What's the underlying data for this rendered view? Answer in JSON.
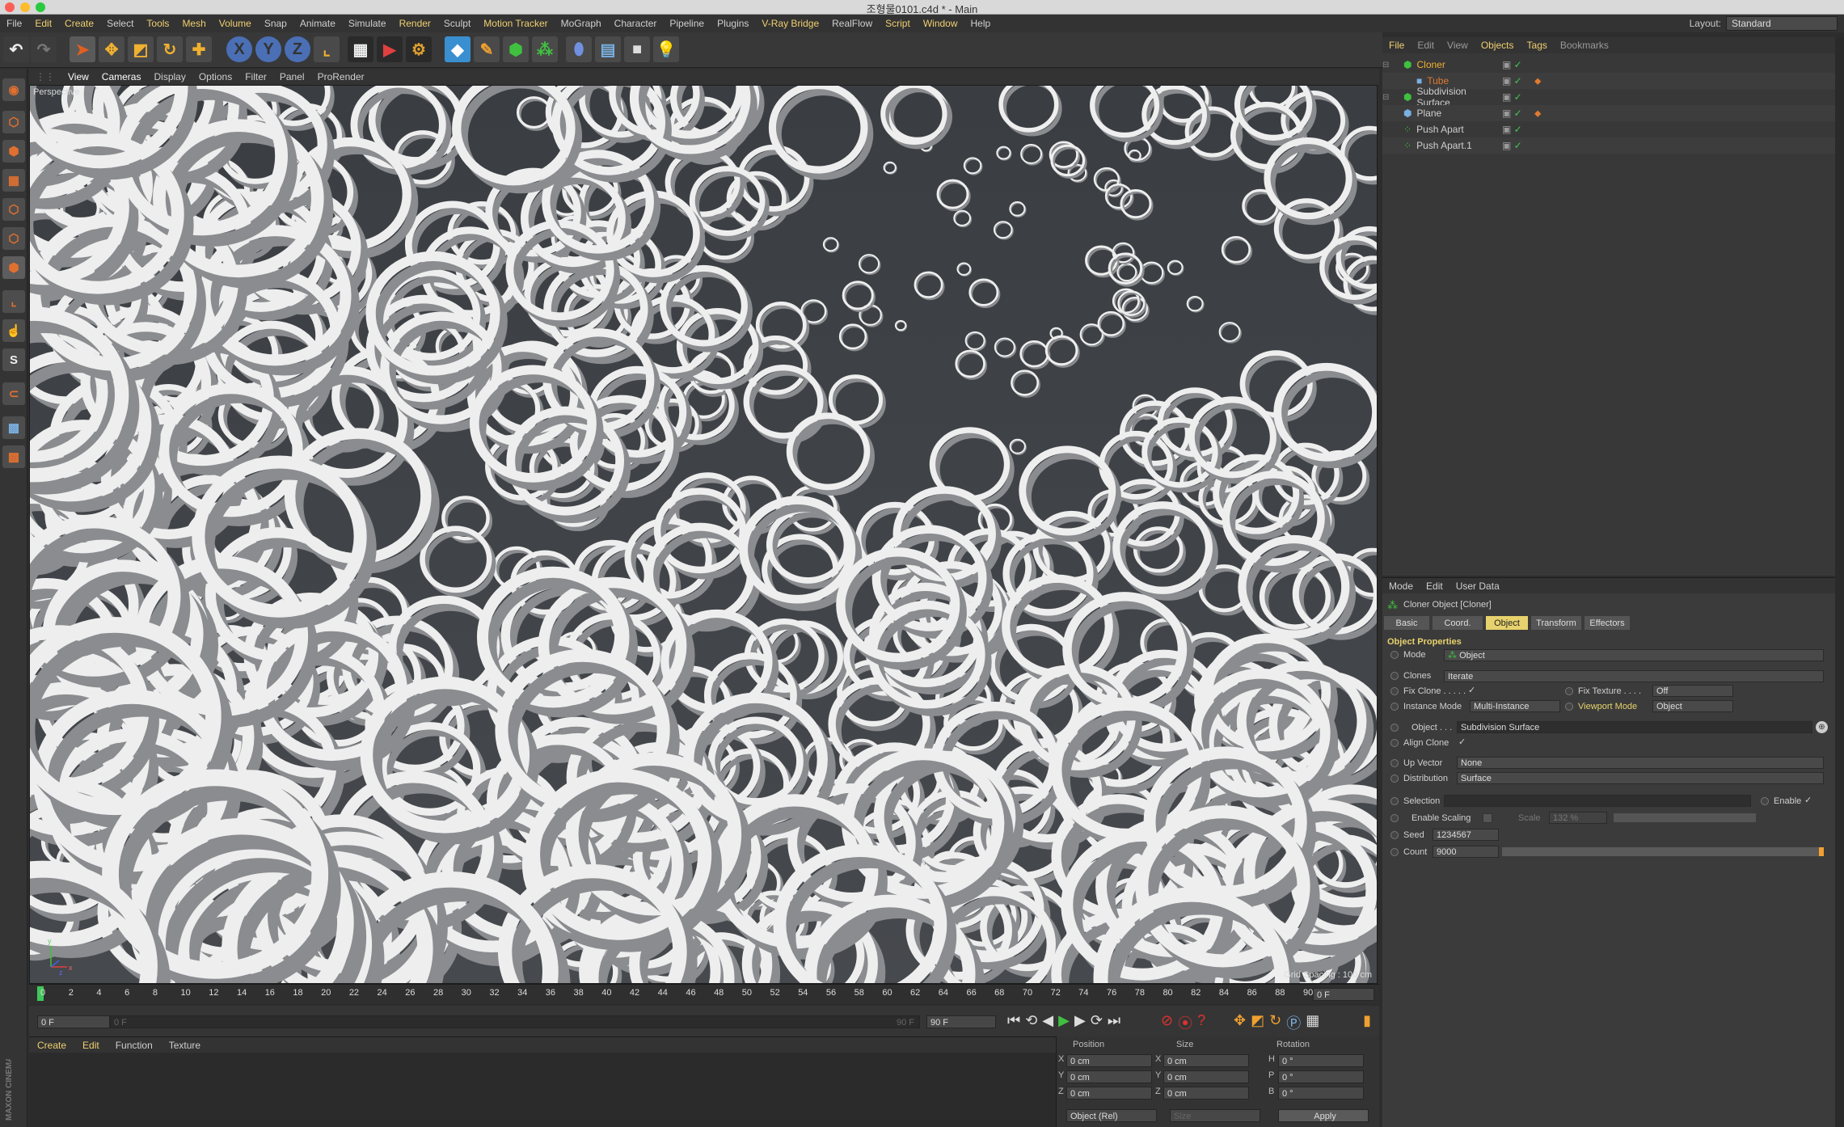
{
  "window": {
    "title": "조형물0101.c4d * - Main"
  },
  "menubar": {
    "items": [
      "File",
      "Edit",
      "Create",
      "Select",
      "Tools",
      "Mesh",
      "Volume",
      "Snap",
      "Animate",
      "Simulate",
      "Render",
      "Sculpt",
      "Motion Tracker",
      "MoGraph",
      "Character",
      "Pipeline",
      "Plugins",
      "V-Ray Bridge",
      "RealFlow",
      "Script",
      "Window",
      "Help"
    ],
    "highlighted": [
      "Edit",
      "Create",
      "Tools",
      "Mesh",
      "Volume",
      "Render",
      "Motion Tracker",
      "V-Ray Bridge",
      "Script",
      "Window"
    ],
    "layout_label": "Layout:",
    "layout_value": "Standard"
  },
  "toolbar": {
    "axis_x": "X",
    "axis_y": "Y",
    "axis_z": "Z",
    "icons": [
      "undo-icon",
      "redo-icon",
      "select-arrow-icon",
      "move-icon",
      "scale-icon",
      "rotate-icon",
      "add-icon",
      "x-axis-icon",
      "y-axis-icon",
      "z-axis-icon",
      "coordinate-system-icon",
      "render-view-icon",
      "render-picture-viewer-icon",
      "render-settings-icon",
      "cube-icon",
      "pen-icon",
      "subdivision-icon",
      "cloner-icon",
      "deformer-icon",
      "plane-grid-icon",
      "camera-icon",
      "light-icon"
    ]
  },
  "leftbar": {
    "icons": [
      "make-editable-icon",
      "model-mode-icon",
      "texture-mode-icon",
      "workplane-icon",
      "points-mode-icon",
      "edges-mode-icon",
      "polygons-mode-icon",
      "axis-mode-icon",
      "tweak-mode-icon",
      "solo-mode-icon",
      "snap-icon",
      "grid-snap-icon",
      "locked-workplane-icon"
    ],
    "solo_label": "S"
  },
  "viewport": {
    "menu": [
      "View",
      "Cameras",
      "Display",
      "Options",
      "Filter",
      "Panel",
      "ProRender"
    ],
    "active_menu": "View",
    "label": "Perspective",
    "grid_spacing": "Grid Spacing : 100 cm",
    "axis_labels": {
      "x": "x",
      "y": "y",
      "z": "z"
    }
  },
  "timeline": {
    "ticks": [
      "0",
      "2",
      "4",
      "6",
      "8",
      "10",
      "12",
      "14",
      "16",
      "18",
      "20",
      "22",
      "24",
      "26",
      "28",
      "30",
      "32",
      "34",
      "36",
      "38",
      "40",
      "42",
      "44",
      "46",
      "48",
      "50",
      "52",
      "54",
      "56",
      "58",
      "60",
      "62",
      "64",
      "66",
      "68",
      "70",
      "72",
      "74",
      "76",
      "78",
      "80",
      "82",
      "84",
      "86",
      "88",
      "90"
    ],
    "current_frame": "0 F",
    "start": "0 F",
    "range_start": "0 F",
    "range_end": "90 F",
    "end": "90 F",
    "end_frame": "90 F"
  },
  "materials": {
    "menu": [
      "Create",
      "Edit",
      "Function",
      "Texture"
    ]
  },
  "coordinates": {
    "headers": {
      "position": "Position",
      "size": "Size",
      "rotation": "Rotation"
    },
    "rows": [
      {
        "axis": "X",
        "pos": "0 cm",
        "size_axis": "X",
        "size": "0 cm",
        "rot_axis": "H",
        "rot": "0 °"
      },
      {
        "axis": "Y",
        "pos": "0 cm",
        "size_axis": "Y",
        "size": "0 cm",
        "rot_axis": "P",
        "rot": "0 °"
      },
      {
        "axis": "Z",
        "pos": "0 cm",
        "size_axis": "Z",
        "size": "0 cm",
        "rot_axis": "B",
        "rot": "0 °"
      }
    ],
    "mode": "Object (Rel)",
    "size_mode": "Size",
    "apply": "Apply"
  },
  "objects": {
    "menu": [
      "File",
      "Edit",
      "View",
      "Objects",
      "Tags",
      "Bookmarks"
    ],
    "active_menu": [
      "File",
      "Objects",
      "Tags"
    ],
    "items": [
      {
        "name": "Cloner",
        "indent": 0,
        "color": "#f0b030",
        "icon": "cloner-icon"
      },
      {
        "name": "Tube",
        "indent": 1,
        "color": "#e07a30",
        "icon": "tube-icon"
      },
      {
        "name": "Subdivision Surface",
        "indent": 0,
        "color": "#cfcfcf",
        "icon": "subdivision-icon"
      },
      {
        "name": "Plane",
        "indent": 0,
        "color": "#cfcfcf",
        "icon": "plane-icon"
      },
      {
        "name": "Push Apart",
        "indent": 0,
        "color": "#cfcfcf",
        "icon": "push-apart-icon"
      },
      {
        "name": "Push Apart.1",
        "indent": 0,
        "color": "#cfcfcf",
        "icon": "push-apart-icon"
      }
    ]
  },
  "attributes": {
    "menu": [
      "Mode",
      "Edit",
      "User Data"
    ],
    "object_title": "Cloner Object [Cloner]",
    "tabs": [
      "Basic",
      "Coord.",
      "Object",
      "Transform",
      "Effectors"
    ],
    "active_tab": "Object",
    "section": "Object Properties",
    "mode_label": "Mode",
    "mode_value": "Object",
    "clones_label": "Clones",
    "clones_value": "Iterate",
    "fix_clone_label": "Fix Clone . . . . .",
    "fix_clone_check": "✓",
    "fix_texture_label": "Fix Texture . . . .",
    "fix_texture_value": "Off",
    "instance_mode_label": "Instance Mode",
    "instance_mode_value": "Multi-Instance",
    "viewport_mode_label": "Viewport Mode",
    "viewport_mode_value": "Object",
    "object_label": "Object . . .",
    "object_value": "Subdivision Surface",
    "align_clone_label": "Align Clone",
    "align_clone_check": "✓",
    "up_vector_label": "Up Vector",
    "up_vector_value": "None",
    "distribution_label": "Distribution",
    "distribution_value": "Surface",
    "selection_label": "Selection",
    "enable_label": "Enable",
    "enable_check": "✓",
    "enable_scaling_label": "Enable Scaling",
    "scale_label": "Scale",
    "scale_value": "132 %",
    "seed_label": "Seed",
    "seed_value": "1234567",
    "count_label": "Count",
    "count_value": "9000"
  },
  "brand": "MAXON CINEMA 4D"
}
